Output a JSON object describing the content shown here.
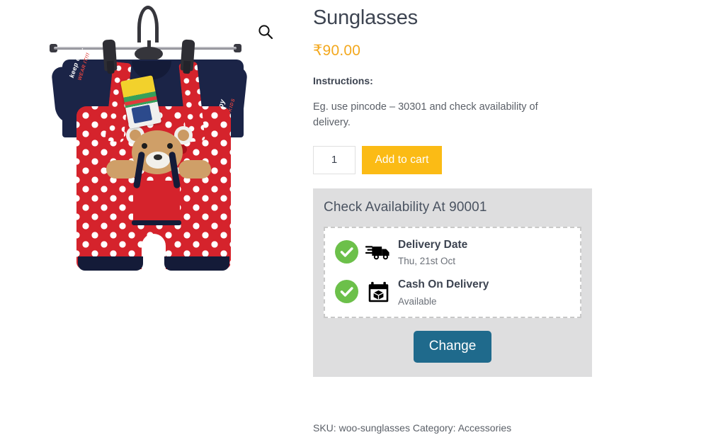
{
  "product": {
    "title": "Sunglasses",
    "price": "₹90.00",
    "instructions_label": "Instructions:",
    "instructions_text": "Eg. use pincode – 30301 and check availability of delivery."
  },
  "gallery": {
    "zoom_icon": "search-icon",
    "image_alt": "Kids navy t-shirt with red polka dot dungaree on hanger"
  },
  "cart": {
    "quantity": "1",
    "quantity_placeholder": "1",
    "add_to_cart_label": "Add to cart"
  },
  "availability": {
    "heading": "Check Availability At 90001",
    "rows": [
      {
        "icon": "delivery-truck-icon",
        "status_icon": "check-circle-icon",
        "title": "Delivery Date",
        "value": "Thu, 21st Oct"
      },
      {
        "icon": "calendar-box-icon",
        "status_icon": "check-circle-icon",
        "title": "Cash On Delivery",
        "value": "Available"
      }
    ],
    "change_label": "Change"
  },
  "meta": {
    "sku_label": "SKU:",
    "sku_value": "woo-sunglasses",
    "category_label": "Category:",
    "category_value": "Accessories"
  },
  "colors": {
    "price": "#f3a81e",
    "add_to_cart": "#fbbb15",
    "change_button": "#1f6a8c",
    "panel": "#dededf",
    "check_green": "#6cc04a"
  }
}
